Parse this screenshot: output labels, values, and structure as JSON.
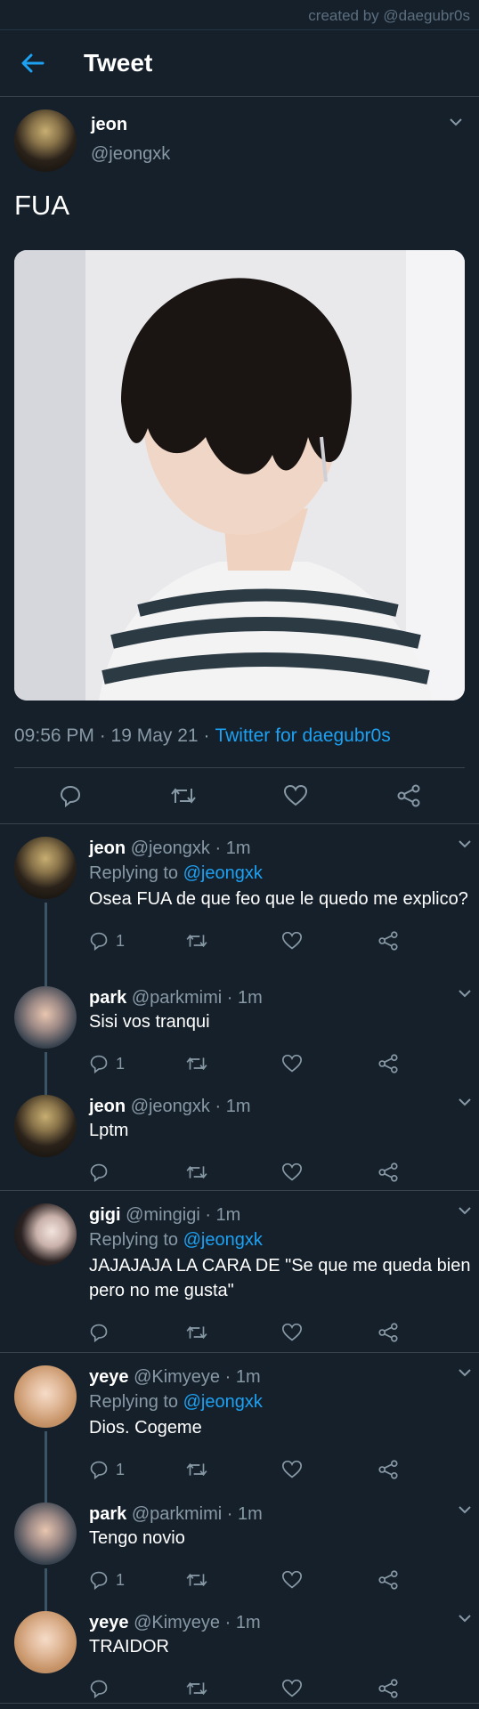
{
  "credit": "created by @daegubr0s",
  "header": {
    "title": "Tweet"
  },
  "tweet": {
    "name": "jeon",
    "handle": "@jeongxk",
    "text": "FUA",
    "time": "09:56 PM · 19 May 21 ·",
    "source": "Twitter for daegubr0s"
  },
  "replies": [
    {
      "name": "jeon",
      "meta": "@jeongxk · 1m",
      "replying_label": "Replying to",
      "replying_to": "@jeongxk",
      "text": "Osea FUA de que feo que le quedo me explico?",
      "reply_count": "1"
    },
    {
      "name": "park",
      "meta": "@parkmimi · 1m",
      "text": "Sisi vos tranqui",
      "reply_count": "1"
    },
    {
      "name": "jeon",
      "meta": "@jeongxk · 1m",
      "text": "Lptm",
      "reply_count": ""
    },
    {
      "name": "gigi",
      "meta": "@mingigi · 1m",
      "replying_label": "Replying to",
      "replying_to": "@jeongxk",
      "text": "JAJAJAJA LA CARA DE \"Se que me queda bien pero no me gusta\"",
      "reply_count": ""
    },
    {
      "name": "yeye",
      "meta": "@Kimyeye · 1m",
      "replying_label": "Replying to",
      "replying_to": "@jeongxk",
      "text": "Dios. Cogeme",
      "reply_count": "1"
    },
    {
      "name": "park",
      "meta": "@parkmimi · 1m",
      "text": "Tengo novio",
      "reply_count": "1"
    },
    {
      "name": "yeye",
      "meta": "@Kimyeye · 1m",
      "text": "TRAIDOR",
      "reply_count": ""
    }
  ],
  "colors": {
    "background": "#15202b",
    "accent": "#1da1f2",
    "muted": "#8899a6",
    "divider": "#38444d"
  }
}
